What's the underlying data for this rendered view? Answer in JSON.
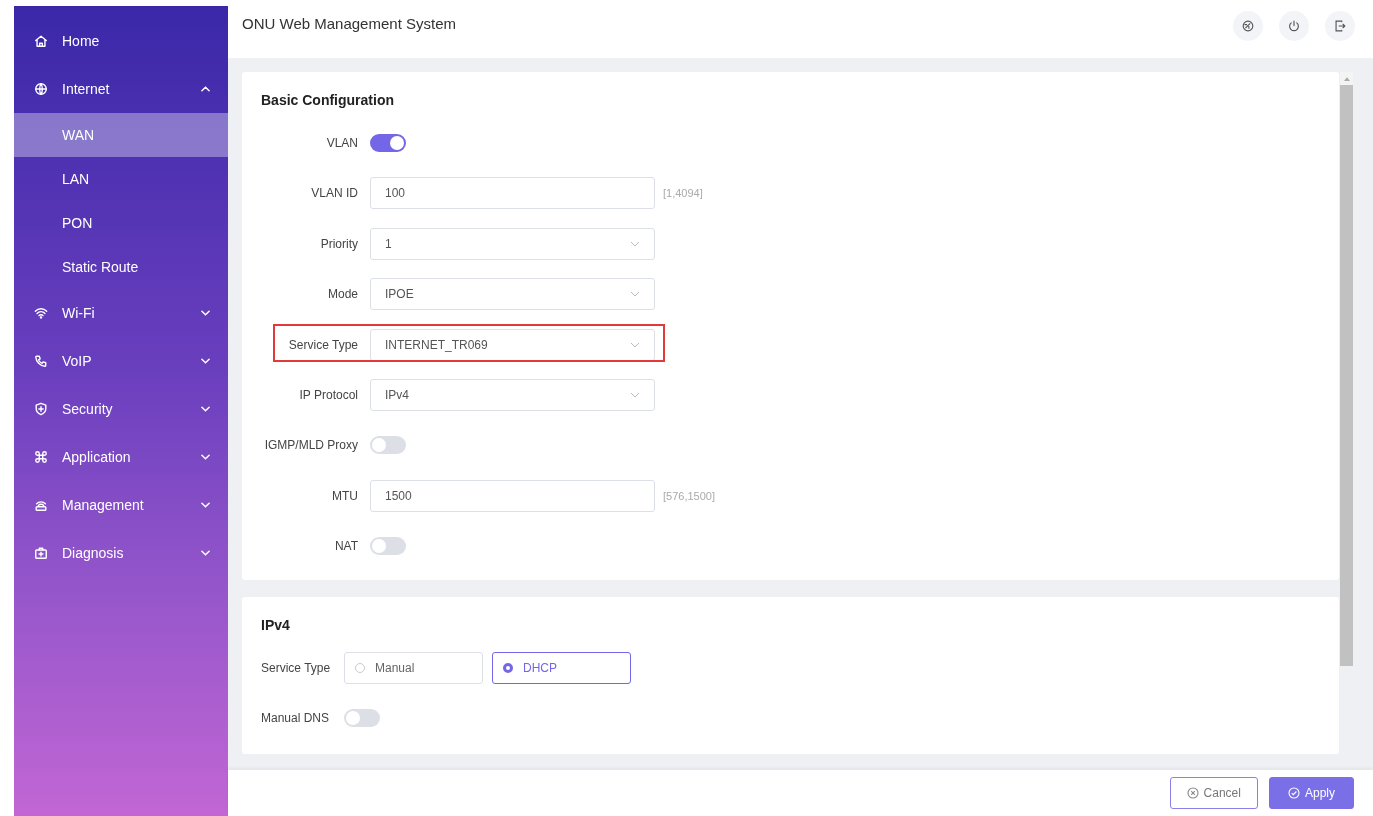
{
  "sidebar": {
    "items": [
      {
        "label": "Home",
        "kind": "link"
      },
      {
        "label": "Internet",
        "kind": "group",
        "expanded": true,
        "children": [
          {
            "label": "WAN",
            "selected": true
          },
          {
            "label": "LAN",
            "selected": false
          },
          {
            "label": "PON",
            "selected": false
          },
          {
            "label": "Static Route",
            "selected": false
          }
        ]
      },
      {
        "label": "Wi-Fi",
        "kind": "group",
        "expanded": false
      },
      {
        "label": "VoIP",
        "kind": "group",
        "expanded": false
      },
      {
        "label": "Security",
        "kind": "group",
        "expanded": false
      },
      {
        "label": "Application",
        "kind": "group",
        "expanded": false
      },
      {
        "label": "Management",
        "kind": "group",
        "expanded": false
      },
      {
        "label": "Diagnosis",
        "kind": "group",
        "expanded": false
      }
    ]
  },
  "header": {
    "title": "ONU Web Management System"
  },
  "basic": {
    "title": "Basic Configuration",
    "fields": [
      {
        "kind": "toggle",
        "label": "VLAN",
        "on": true,
        "highlighted": false
      },
      {
        "kind": "input",
        "label": "VLAN ID",
        "value": "100",
        "hint": "[1,4094]",
        "highlighted": false
      },
      {
        "kind": "select",
        "label": "Priority",
        "value": "1",
        "highlighted": false
      },
      {
        "kind": "select",
        "label": "Mode",
        "value": "IPOE",
        "highlighted": false
      },
      {
        "kind": "select",
        "label": "Service Type",
        "value": "INTERNET_TR069",
        "highlighted": true
      },
      {
        "kind": "select",
        "label": "IP Protocol",
        "value": "IPv4",
        "highlighted": false
      },
      {
        "kind": "toggle",
        "label": "IGMP/MLD Proxy",
        "on": false,
        "highlighted": false
      },
      {
        "kind": "input",
        "label": "MTU",
        "value": "1500",
        "hint": "[576,1500]",
        "highlighted": false
      },
      {
        "kind": "toggle",
        "label": "NAT",
        "on": false,
        "highlighted": false
      }
    ]
  },
  "ipv4": {
    "title": "IPv4",
    "service_type": {
      "label": "Service Type",
      "options": [
        {
          "label": "Manual",
          "selected": false
        },
        {
          "label": "DHCP",
          "selected": true
        }
      ]
    },
    "manual_dns": {
      "label": "Manual DNS",
      "on": false
    }
  },
  "footer": {
    "buttons": [
      {
        "label": "Cancel",
        "kind": "secondary"
      },
      {
        "label": "Apply",
        "kind": "primary"
      }
    ]
  }
}
